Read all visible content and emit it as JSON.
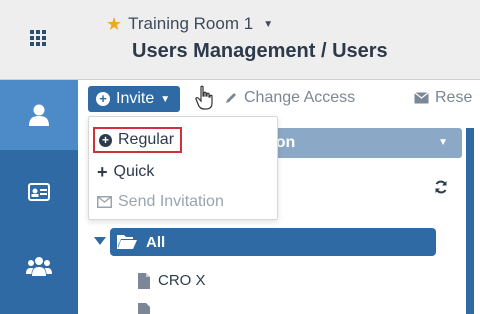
{
  "header": {
    "room_name": "Training Room 1",
    "page_title": "Users Management / Users"
  },
  "toolbar": {
    "invite_label": "Invite",
    "change_access_label": "Change Access",
    "reset_label": "Rese"
  },
  "invite_menu": {
    "items": [
      {
        "label": "Regular",
        "icon": "plus-circle-icon",
        "highlighted": true
      },
      {
        "label": "Quick",
        "icon": "plus-icon"
      },
      {
        "label": "Send Invitation",
        "icon": "envelope-icon",
        "disabled": true
      }
    ]
  },
  "panel": {
    "header_label": "tion"
  },
  "tree": {
    "root_label": "All",
    "items": [
      {
        "label": "CRO X"
      }
    ]
  },
  "colors": {
    "primary": "#2f6aa5",
    "rail_active": "#4d8bc8",
    "highlight_border": "#d0303a",
    "star": "#f0a81c"
  }
}
